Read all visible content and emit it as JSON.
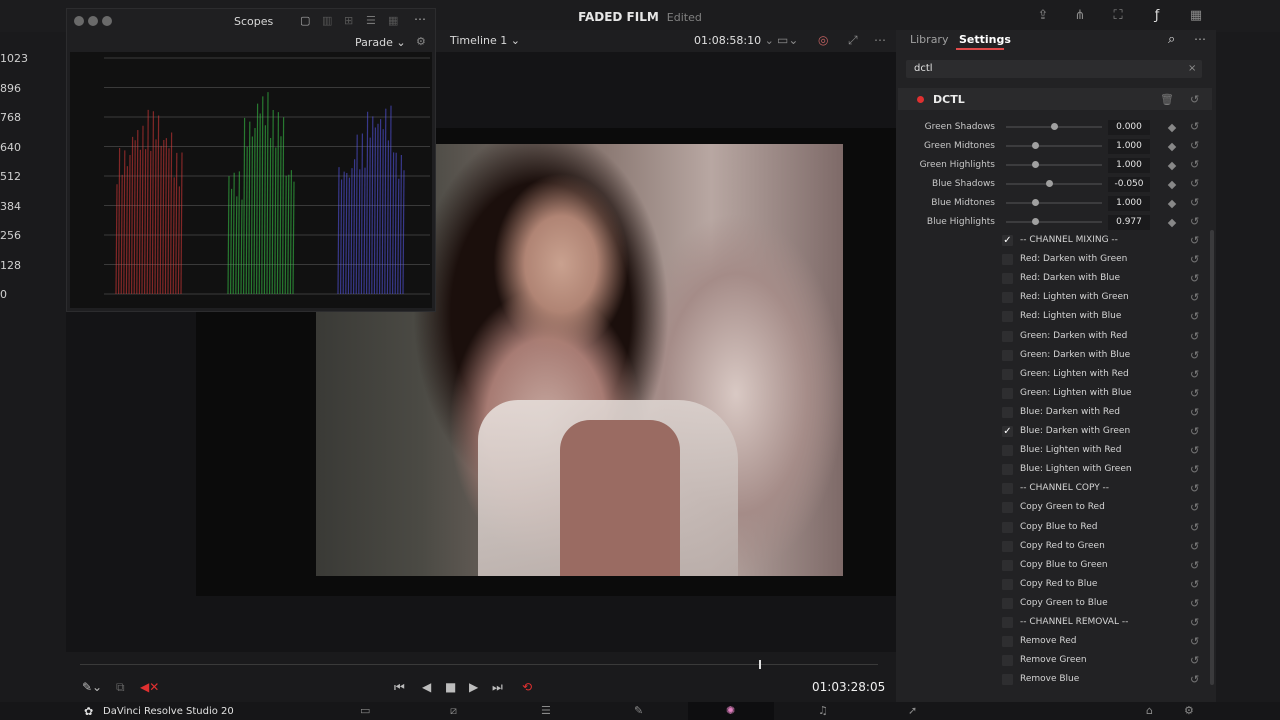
{
  "window": {
    "project_title": "FADED FILM",
    "status": "Edited"
  },
  "viewer": {
    "timeline_name": "Timeline 1",
    "timecode_top": "01:08:58:10",
    "timecode_bottom": "01:03:28:05"
  },
  "scopes": {
    "title": "Scopes",
    "mode": "Parade",
    "scale_labels": [
      "1023",
      "896",
      "768",
      "640",
      "512",
      "384",
      "256",
      "128",
      "0"
    ],
    "channel_colors": {
      "red": "#e03a3a",
      "green": "#3ad04a",
      "blue": "#5a5af0"
    }
  },
  "panel": {
    "tabs": [
      "Library",
      "Settings"
    ],
    "active_tab": "Settings",
    "search_value": "dctl",
    "effect_name": "DCTL",
    "params": [
      {
        "label": "Green Shadows",
        "value": "0.000",
        "level": 0.5
      },
      {
        "label": "Green Midtones",
        "value": "1.000",
        "level": 0.3
      },
      {
        "label": "Green Highlights",
        "value": "1.000",
        "level": 0.3
      },
      {
        "label": "Blue Shadows",
        "value": "-0.050",
        "level": 0.45
      },
      {
        "label": "Blue Midtones",
        "value": "1.000",
        "level": 0.3
      },
      {
        "label": "Blue Highlights",
        "value": "0.977",
        "level": 0.3
      }
    ],
    "checkboxes": [
      {
        "label": "-- CHANNEL MIXING --",
        "checked": true
      },
      {
        "label": "Red: Darken with Green",
        "checked": false
      },
      {
        "label": "Red: Darken with Blue",
        "checked": false
      },
      {
        "label": "Red: Lighten with Green",
        "checked": false
      },
      {
        "label": "Red: Lighten with Blue",
        "checked": false
      },
      {
        "label": "Green: Darken with Red",
        "checked": false
      },
      {
        "label": "Green: Darken with Blue",
        "checked": false
      },
      {
        "label": "Green: Lighten with Red",
        "checked": false
      },
      {
        "label": "Green: Lighten with Blue",
        "checked": false
      },
      {
        "label": "Blue: Darken with Red",
        "checked": false
      },
      {
        "label": "Blue: Darken with Green",
        "checked": true
      },
      {
        "label": "Blue: Lighten with Red",
        "checked": false
      },
      {
        "label": "Blue: Lighten with Green",
        "checked": false
      },
      {
        "label": "-- CHANNEL COPY --",
        "checked": false
      },
      {
        "label": "Copy Green to Red",
        "checked": false
      },
      {
        "label": "Copy Blue to Red",
        "checked": false
      },
      {
        "label": "Copy Red to Green",
        "checked": false
      },
      {
        "label": "Copy Blue to Green",
        "checked": false
      },
      {
        "label": "Copy Red to Blue",
        "checked": false
      },
      {
        "label": "Copy Green to Blue",
        "checked": false
      },
      {
        "label": "-- CHANNEL REMOVAL --",
        "checked": false
      },
      {
        "label": "Remove Red",
        "checked": false
      },
      {
        "label": "Remove Green",
        "checked": false
      },
      {
        "label": "Remove Blue",
        "checked": false
      }
    ]
  },
  "footer": {
    "app_name": "DaVinci Resolve Studio 20"
  },
  "icons": {
    "scopes_menu": "ellipsis-icon",
    "search": "search-icon",
    "trash": "trash-icon",
    "reset": "reset-icon",
    "play": "play-icon",
    "stop": "stop-icon",
    "loop": "loop-icon"
  }
}
